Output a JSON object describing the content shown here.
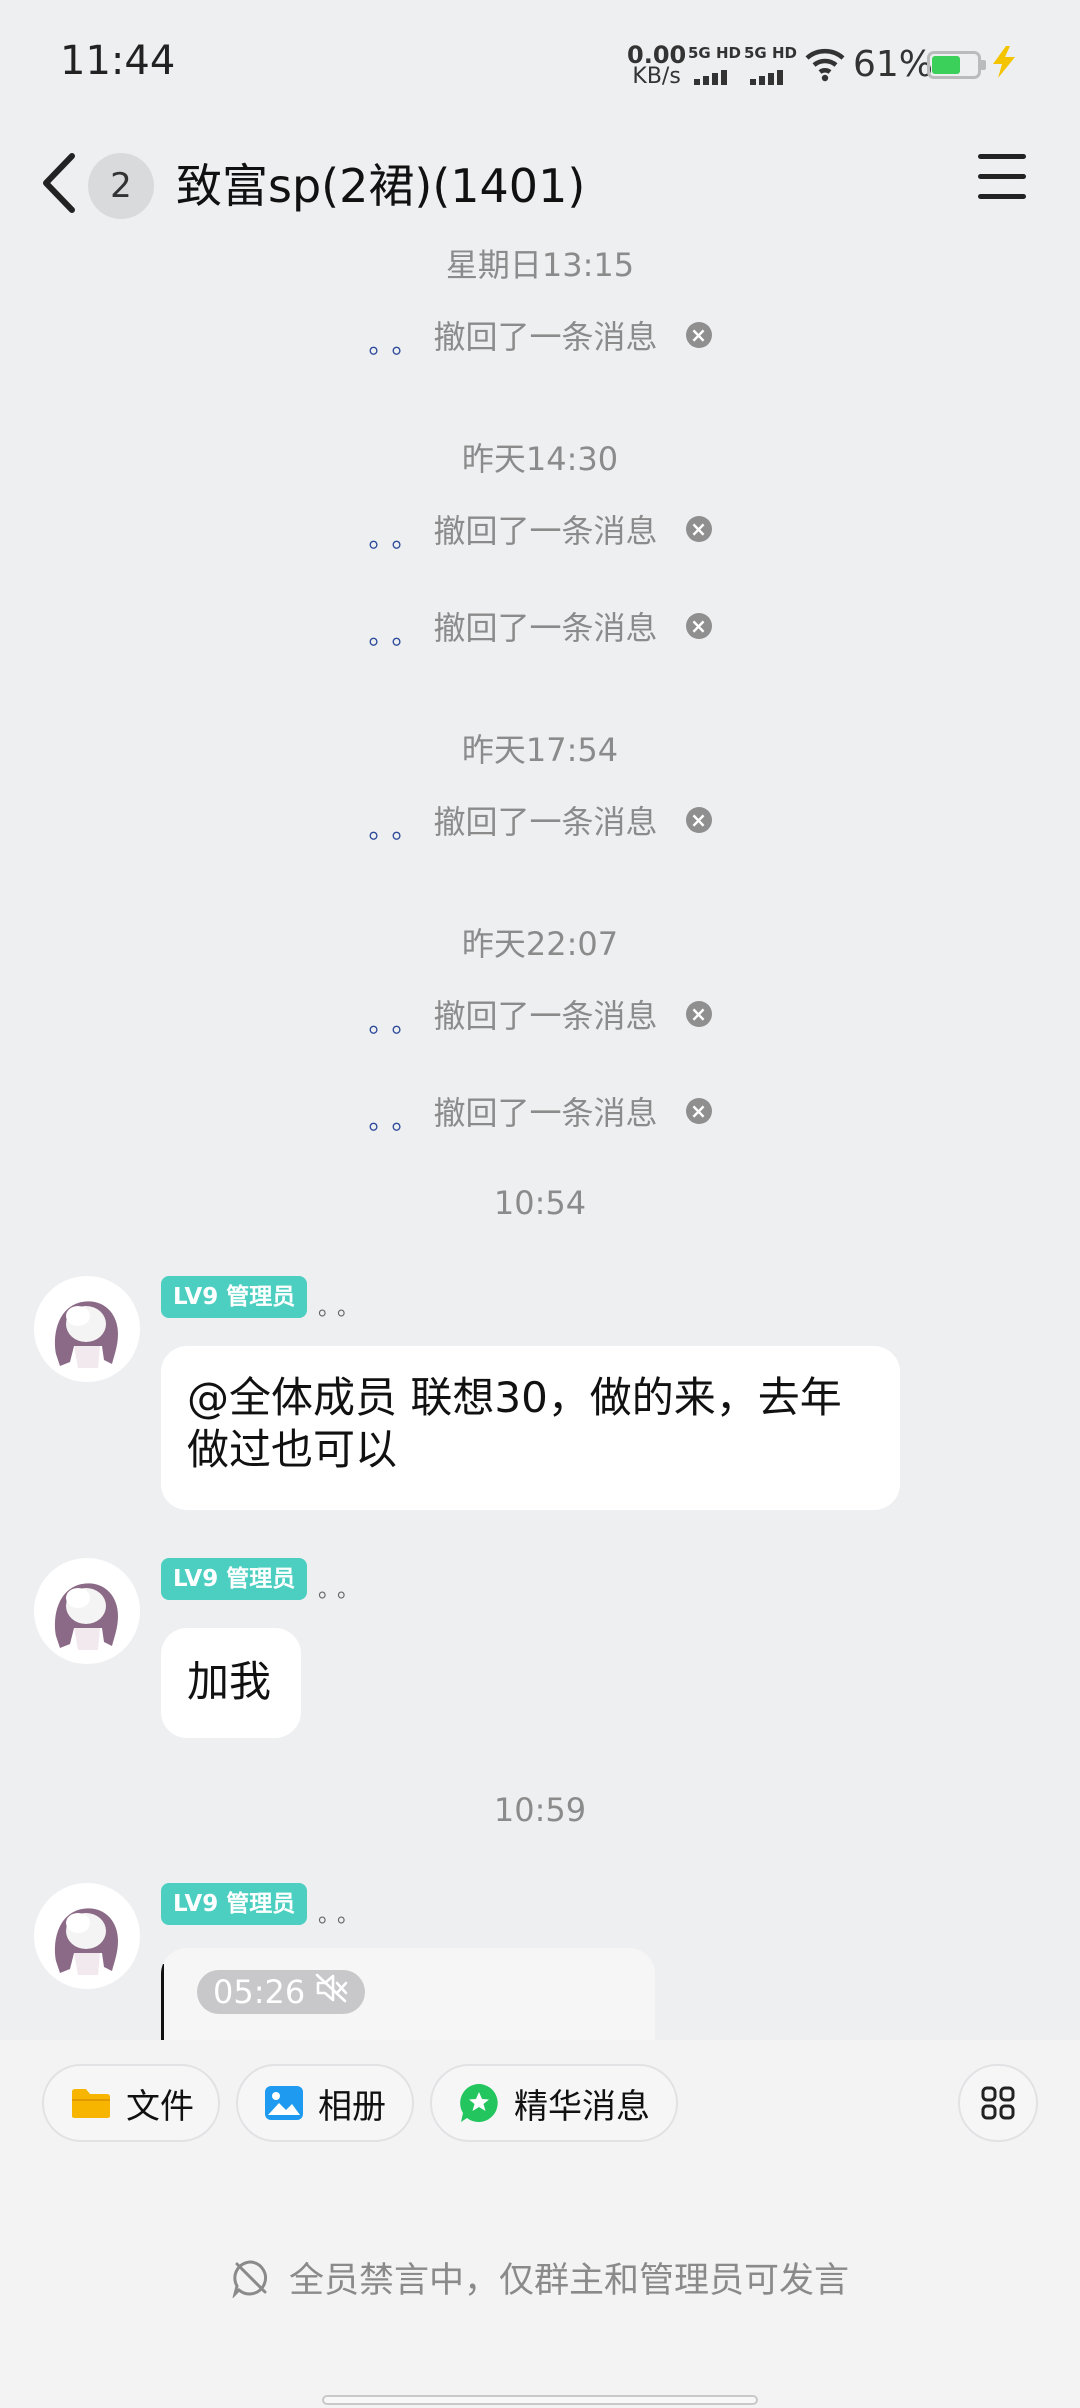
{
  "status_bar": {
    "time": "11:44",
    "net_speed_value": "0.00",
    "net_speed_unit": "KB/s",
    "sim1_label": "5G HD",
    "sim2_label": "5G HD",
    "battery_percent": "61%",
    "battery_level": 0.61
  },
  "header": {
    "unread_count": "2",
    "title": "致富sp(2裙)(1401)"
  },
  "messages": {
    "ts1": "星期日13:15",
    "ts2": "昨天14:30",
    "ts3": "昨天17:54",
    "ts4": "昨天22:07",
    "ts5": "10:54",
    "ts6": "10:59",
    "recall_nick": "。。",
    "recall_text": "撤回了一条消息",
    "badge": "LV9 管理员",
    "sender_nick": "。。",
    "msg1": "@全体成员 联想30，做的来，去年做过也可以",
    "msg2": "加我",
    "video_duration": "05:26"
  },
  "toolbar": {
    "file_label": "文件",
    "album_label": "相册",
    "essence_label": "精华消息"
  },
  "muted_notice": "全员禁言中，仅群主和管理员可发言",
  "colors": {
    "background": "#EEEFF1",
    "badge": "#4CCFC1",
    "nickname": "#2D4A9A",
    "battery": "#3AD05A"
  }
}
